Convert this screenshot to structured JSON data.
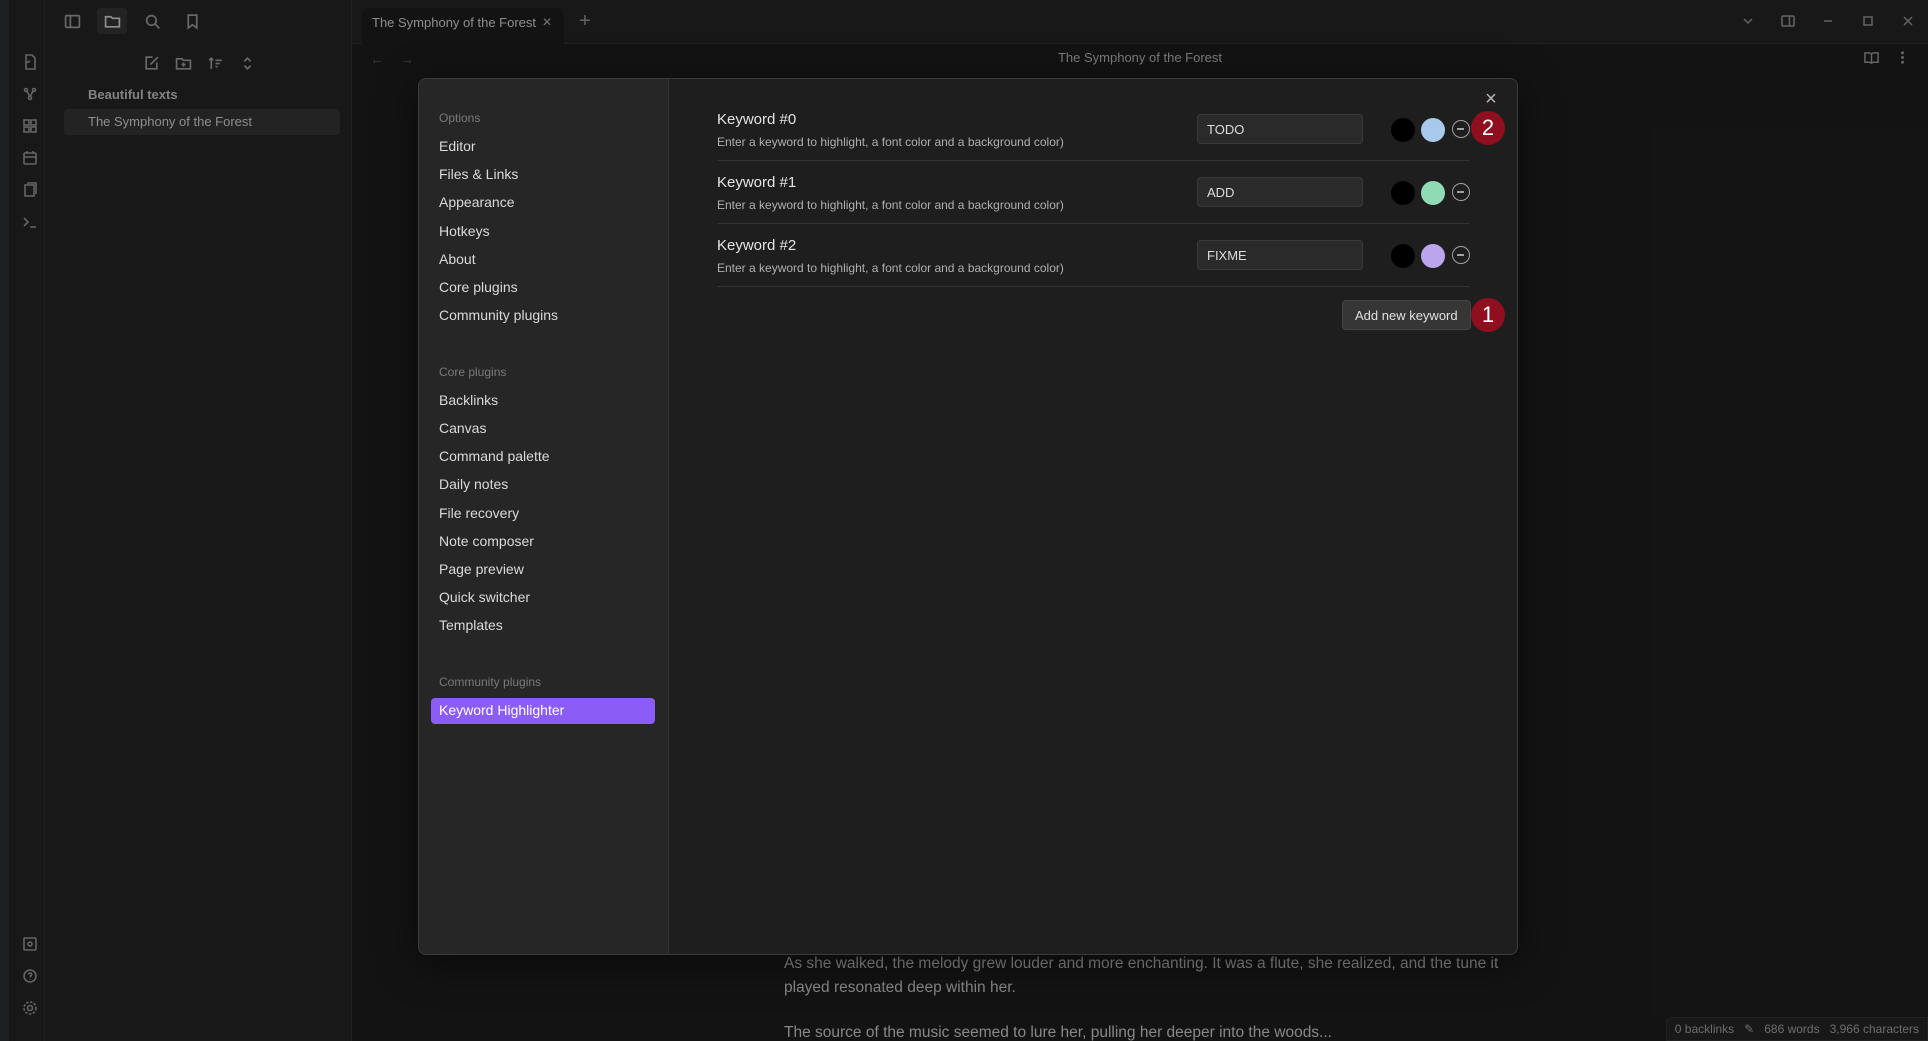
{
  "sidebar": {
    "vault_name": "Beautiful texts",
    "files": [
      "The Symphony of the Forest"
    ]
  },
  "tabs": [
    {
      "label": "The Symphony of the Forest"
    }
  ],
  "view": {
    "title": "The Symphony of the Forest",
    "paragraph": "As she walked, the melody grew louder and more enchanting. It was a flute, she realized, and the tune it played resonated deep within her.",
    "paragraph_cut": "The source of the music seemed to lure her, pulling her deeper into the woods..."
  },
  "status": {
    "backlinks": "0 backlinks",
    "words": "686 words",
    "chars": "3,966 characters"
  },
  "settings_modal": {
    "options_title": "Options",
    "options": [
      "Editor",
      "Files & Links",
      "Appearance",
      "Hotkeys",
      "About",
      "Core plugins",
      "Community plugins"
    ],
    "core_title": "Core plugins",
    "core": [
      "Backlinks",
      "Canvas",
      "Command palette",
      "Daily notes",
      "File recovery",
      "Note composer",
      "Page preview",
      "Quick switcher",
      "Templates"
    ],
    "community_title": "Community plugins",
    "community": [
      "Keyword Highlighter"
    ],
    "keywords": [
      {
        "name": "Keyword #0",
        "desc": "Enter a keyword to highlight, a font color and a background color)",
        "value": "TODO",
        "font_color": "#000000",
        "bg_color": "#a9c9ea"
      },
      {
        "name": "Keyword #1",
        "desc": "Enter a keyword to highlight, a font color and a background color)",
        "value": "ADD",
        "font_color": "#000000",
        "bg_color": "#8fdcb4"
      },
      {
        "name": "Keyword #2",
        "desc": "Enter a keyword to highlight, a font color and a background color)",
        "value": "FIXME",
        "font_color": "#000000",
        "bg_color": "#bba6ee"
      }
    ],
    "add_button": "Add new keyword"
  },
  "markers": [
    "1",
    "2"
  ],
  "colors": {
    "accent": "#8b5cf6",
    "marker": "#8f0f1f"
  }
}
